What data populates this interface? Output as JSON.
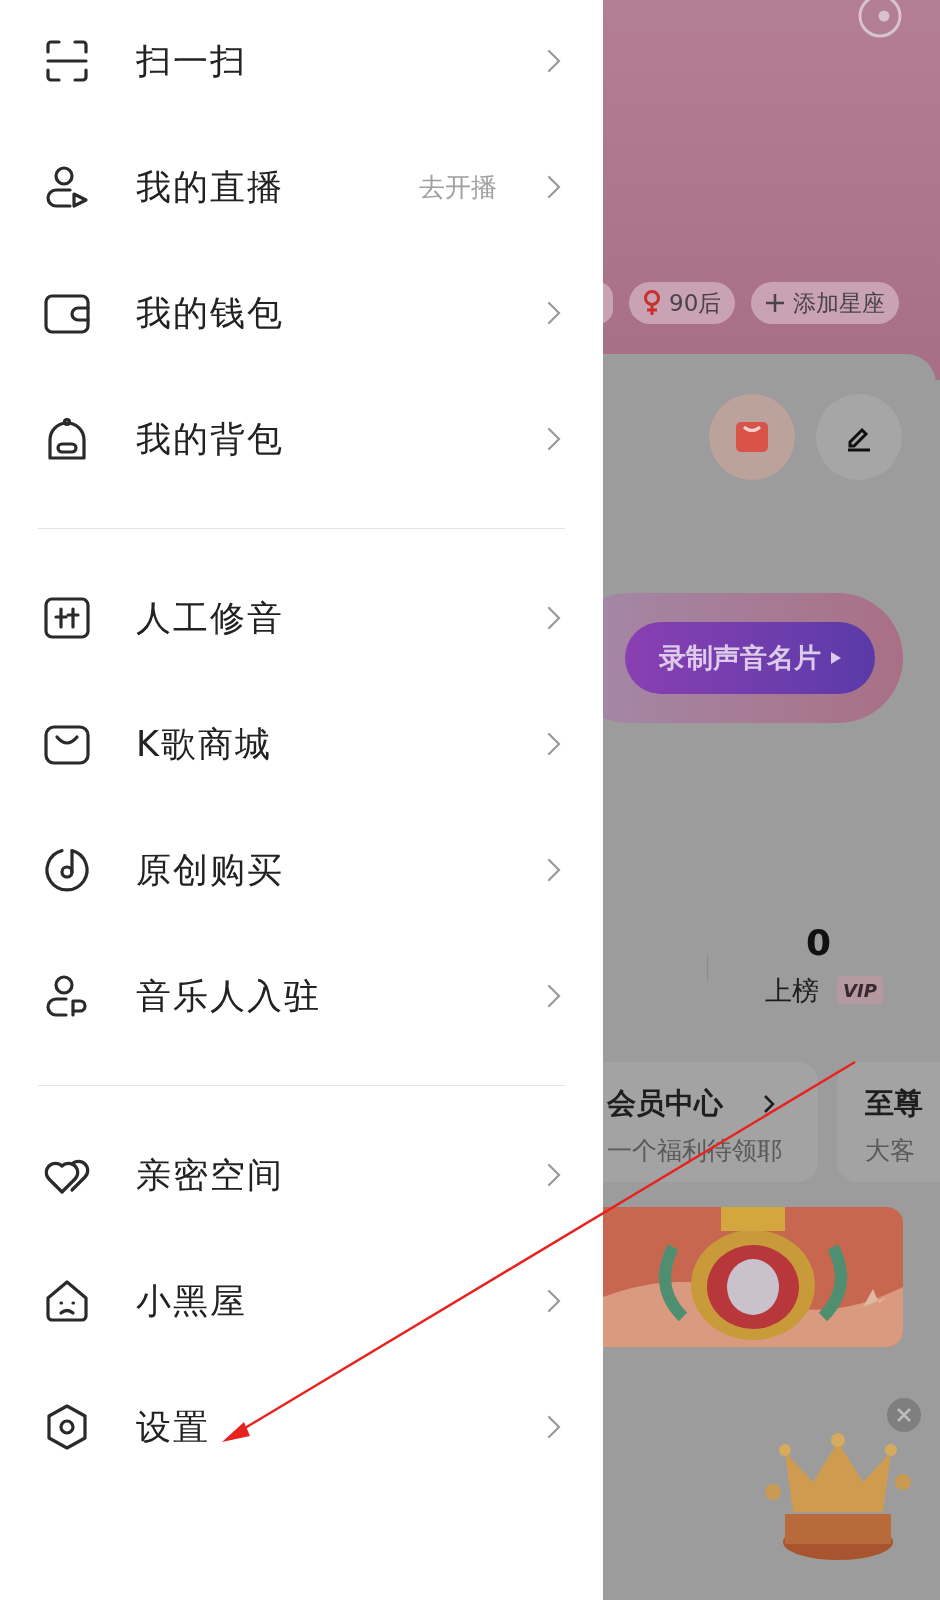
{
  "menu_groups": [
    {
      "items": [
        {
          "kind": "scan",
          "label": "扫一扫"
        },
        {
          "kind": "live",
          "label": "我的直播",
          "hint": "去开播"
        },
        {
          "kind": "wallet",
          "label": "我的钱包"
        },
        {
          "kind": "backpack",
          "label": "我的背包"
        }
      ]
    },
    {
      "items": [
        {
          "kind": "tuning",
          "label": "人工修音"
        },
        {
          "kind": "shop",
          "label": "K歌商城"
        },
        {
          "kind": "disc",
          "label": "原创购买"
        },
        {
          "kind": "musician",
          "label": "音乐人入驻"
        }
      ]
    },
    {
      "items": [
        {
          "kind": "hearts",
          "label": "亲密空间"
        },
        {
          "kind": "house",
          "label": "小黑屋"
        },
        {
          "kind": "settings",
          "label": "设置"
        }
      ]
    }
  ],
  "profile_tags": [
    {
      "kind": "gender",
      "label": "90后"
    },
    {
      "kind": "add",
      "label": "添加星座"
    }
  ],
  "record_button": {
    "label": "录制声音名片"
  },
  "stat": {
    "value": "0",
    "label": "上榜",
    "badge": "VIP"
  },
  "cards": [
    {
      "title": "会员中心",
      "subtitle": "一个福利待领耶"
    },
    {
      "title": "至尊",
      "subtitle": "大客"
    }
  ]
}
